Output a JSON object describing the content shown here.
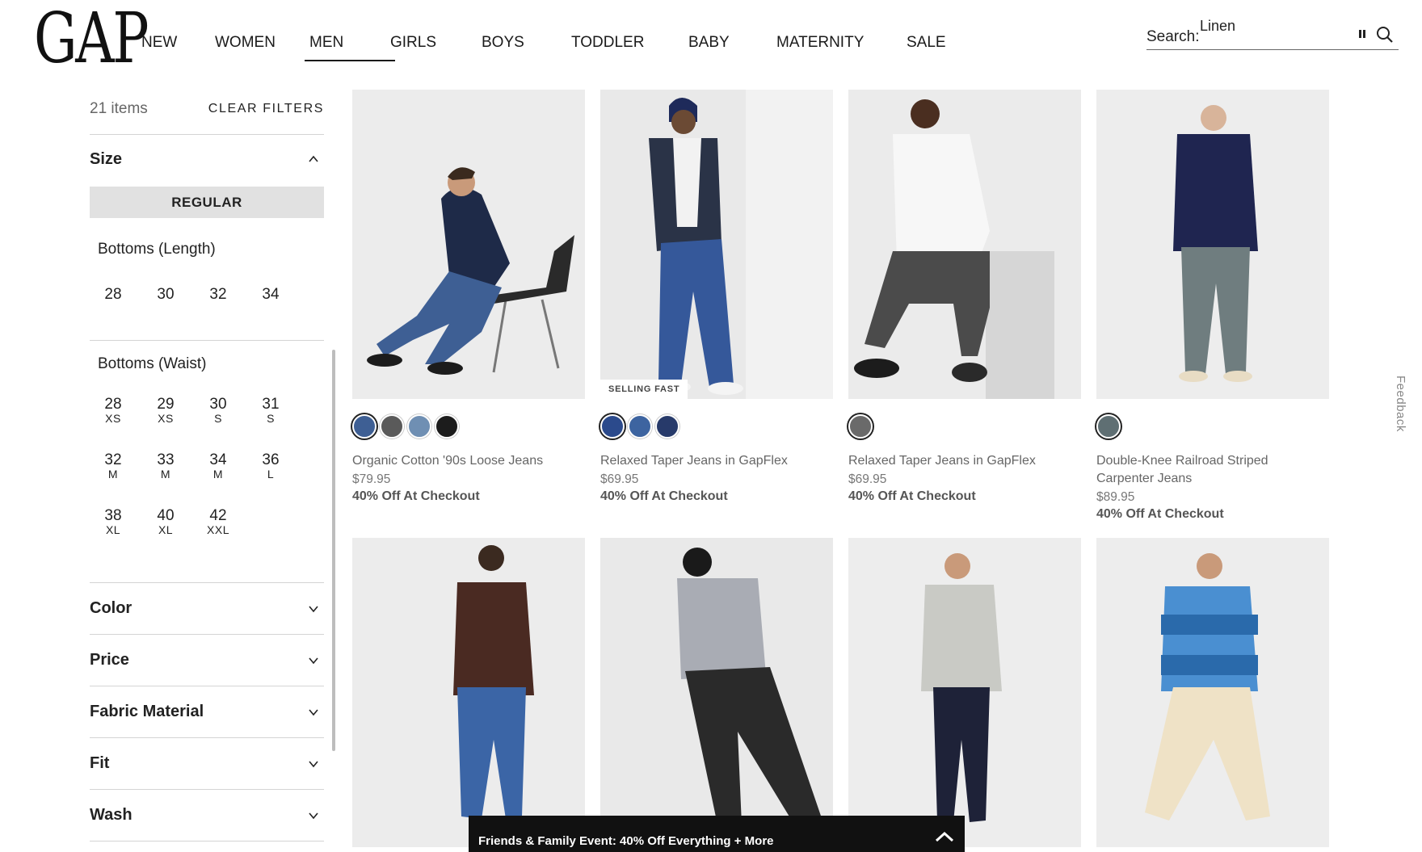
{
  "header": {
    "logo_text": "GAP",
    "nav": [
      "NEW",
      "WOMEN",
      "MEN",
      "GIRLS",
      "BOYS",
      "TODDLER",
      "BABY",
      "MATERNITY",
      "SALE"
    ],
    "active_nav": "MEN",
    "search": {
      "label": "Search:",
      "value": "Linen"
    }
  },
  "sidebar": {
    "items_count": "21 items",
    "clear_filters": "CLEAR FILTERS",
    "size": {
      "title": "Size",
      "selected_chip": "REGULAR",
      "bottoms_length": {
        "title": "Bottoms (Length)",
        "options": [
          "28",
          "30",
          "32",
          "34"
        ]
      },
      "bottoms_waist": {
        "title": "Bottoms (Waist)",
        "options": [
          {
            "n": "28",
            "s": "XS"
          },
          {
            "n": "29",
            "s": "XS"
          },
          {
            "n": "30",
            "s": "S"
          },
          {
            "n": "31",
            "s": "S"
          },
          {
            "n": "32",
            "s": "M"
          },
          {
            "n": "33",
            "s": "M"
          },
          {
            "n": "34",
            "s": "M"
          },
          {
            "n": "36",
            "s": "L"
          },
          {
            "n": "38",
            "s": "XL"
          },
          {
            "n": "40",
            "s": "XL"
          },
          {
            "n": "42",
            "s": "XXL"
          }
        ]
      }
    },
    "facets": [
      "Color",
      "Price",
      "Fabric Material",
      "Fit",
      "Wash"
    ]
  },
  "products": [
    {
      "name": "Organic Cotton '90s Loose Jeans",
      "price": "$79.95",
      "promo": "40% Off At Checkout",
      "badge": "",
      "swatches": [
        "#3e5f94",
        "#5a5a5a",
        "#6f8fb3",
        "#1c1c1c"
      ],
      "selected_swatch": 0
    },
    {
      "name": "Relaxed Taper Jeans in GapFlex",
      "price": "$69.95",
      "promo": "40% Off At Checkout",
      "badge": "SELLING FAST",
      "swatches": [
        "#2b4a8c",
        "#3d64a0",
        "#273a6a"
      ],
      "selected_swatch": 0
    },
    {
      "name": "Relaxed Taper Jeans in GapFlex",
      "price": "$69.95",
      "promo": "40% Off At Checkout",
      "badge": "",
      "swatches": [
        "#6a6a6a"
      ],
      "selected_swatch": 0
    },
    {
      "name": "Double-Knee Railroad Striped Carpenter Jeans",
      "price": "$89.95",
      "promo": "40% Off At Checkout",
      "badge": "",
      "swatches": [
        "#5f6f73"
      ],
      "selected_swatch": 0
    }
  ],
  "feedback_label": "Feedback",
  "promo_bar": {
    "text": "Friends & Family Event: 40% Off Everything + More"
  },
  "colors": {
    "accent": "#111111",
    "chip_bg": "#e1e1e1",
    "divider": "#d4d4d4"
  }
}
